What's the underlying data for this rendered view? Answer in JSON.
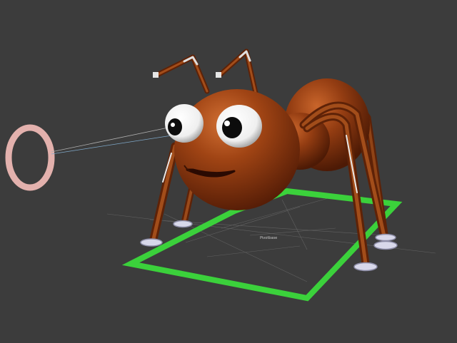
{
  "viewport": {
    "background": "#3c3c3c",
    "grid_line_color": "#6e6e6e"
  },
  "scene": {
    "objects": [
      {
        "name": "ant-character",
        "color": "#7a2f0c"
      },
      {
        "name": "control-rectangle",
        "color": "#3bd13b"
      },
      {
        "name": "eye-target-ring",
        "color": "#e8b8b4"
      }
    ],
    "pivot_label": "Pivotbase"
  }
}
